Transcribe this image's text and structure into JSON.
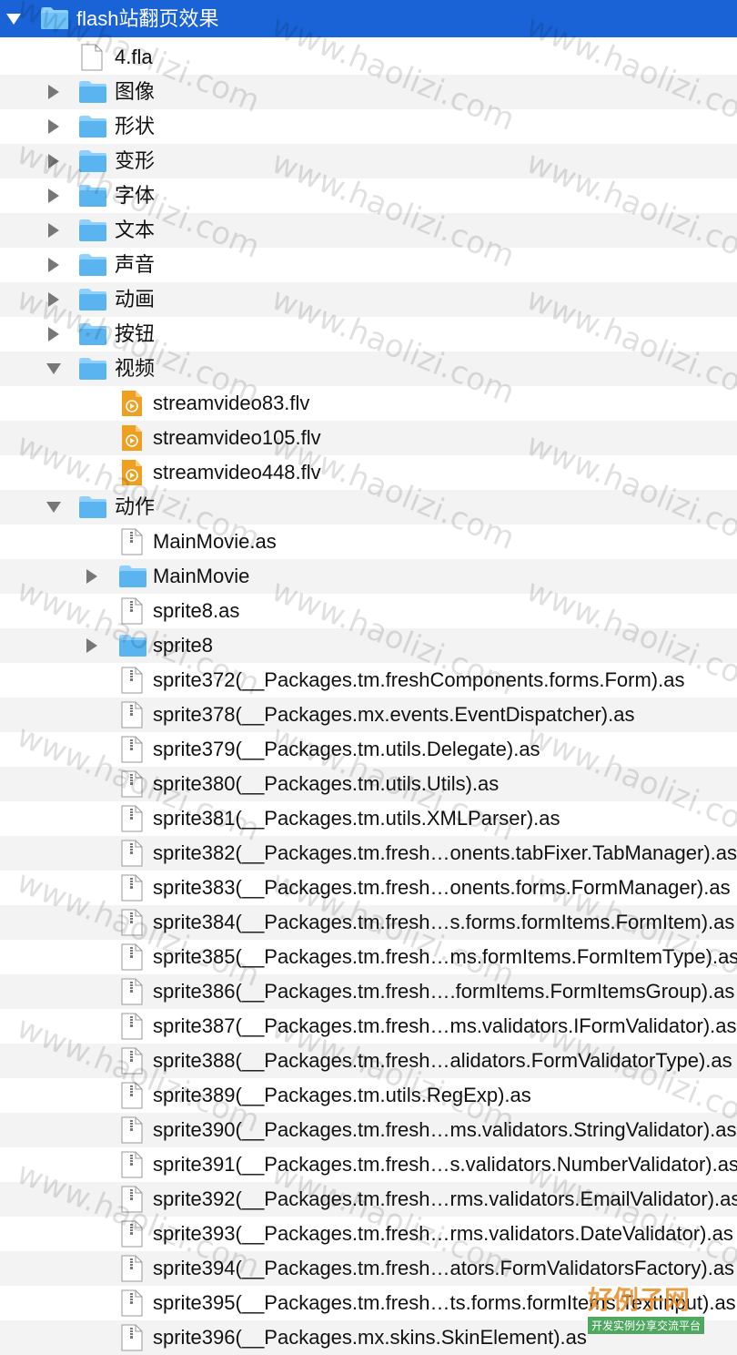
{
  "tree": {
    "root": {
      "label": "flash站翻页效果",
      "expanded": true
    },
    "rows": [
      {
        "type": "file",
        "label": "4.fla"
      },
      {
        "type": "folder",
        "label": "图像",
        "expanded": false
      },
      {
        "type": "folder",
        "label": "形状",
        "expanded": false
      },
      {
        "type": "folder",
        "label": "变形",
        "expanded": false
      },
      {
        "type": "folder",
        "label": "字体",
        "expanded": false
      },
      {
        "type": "folder",
        "label": "文本",
        "expanded": false
      },
      {
        "type": "folder",
        "label": "声音",
        "expanded": false
      },
      {
        "type": "folder",
        "label": "动画",
        "expanded": false
      },
      {
        "type": "folder",
        "label": "按钮",
        "expanded": false
      },
      {
        "type": "folder",
        "label": "视频",
        "expanded": true
      },
      {
        "type": "video",
        "label": "streamvideo83.flv"
      },
      {
        "type": "video",
        "label": "streamvideo105.flv"
      },
      {
        "type": "video",
        "label": "streamvideo448.flv"
      },
      {
        "type": "folder",
        "label": "动作",
        "expanded": true
      },
      {
        "type": "script",
        "label": "MainMovie.as"
      },
      {
        "type": "folder",
        "label": "MainMovie",
        "expanded": false
      },
      {
        "type": "script",
        "label": "sprite8.as"
      },
      {
        "type": "folder",
        "label": "sprite8",
        "expanded": false
      },
      {
        "type": "script",
        "label": "sprite372(__Packages.tm.freshComponents.forms.Form).as"
      },
      {
        "type": "script",
        "label": "sprite378(__Packages.mx.events.EventDispatcher).as"
      },
      {
        "type": "script",
        "label": "sprite379(__Packages.tm.utils.Delegate).as"
      },
      {
        "type": "script",
        "label": "sprite380(__Packages.tm.utils.Utils).as"
      },
      {
        "type": "script",
        "label": "sprite381(__Packages.tm.utils.XMLParser).as"
      },
      {
        "type": "script",
        "label": "sprite382(__Packages.tm.fresh…onents.tabFixer.TabManager).as"
      },
      {
        "type": "script",
        "label": "sprite383(__Packages.tm.fresh…onents.forms.FormManager).as"
      },
      {
        "type": "script",
        "label": "sprite384(__Packages.tm.fresh…s.forms.formItems.FormItem).as"
      },
      {
        "type": "script",
        "label": "sprite385(__Packages.tm.fresh…ms.formItems.FormItemType).as"
      },
      {
        "type": "script",
        "label": "sprite386(__Packages.tm.fresh….formItems.FormItemsGroup).as"
      },
      {
        "type": "script",
        "label": "sprite387(__Packages.tm.fresh…ms.validators.IFormValidator).as"
      },
      {
        "type": "script",
        "label": "sprite388(__Packages.tm.fresh…alidators.FormValidatorType).as"
      },
      {
        "type": "script",
        "label": "sprite389(__Packages.tm.utils.RegExp).as"
      },
      {
        "type": "script",
        "label": "sprite390(__Packages.tm.fresh…ms.validators.StringValidator).as"
      },
      {
        "type": "script",
        "label": "sprite391(__Packages.tm.fresh…s.validators.NumberValidator).as"
      },
      {
        "type": "script",
        "label": "sprite392(__Packages.tm.fresh…rms.validators.EmailValidator).as"
      },
      {
        "type": "script",
        "label": "sprite393(__Packages.tm.fresh…rms.validators.DateValidator).as"
      },
      {
        "type": "script",
        "label": "sprite394(__Packages.tm.fresh…ators.FormValidatorsFactory).as"
      },
      {
        "type": "script",
        "label": "sprite395(__Packages.tm.fresh…ts.forms.formItems.TextInput).as"
      },
      {
        "type": "script",
        "label": "sprite396(__Packages.mx.skins.SkinElement).as"
      }
    ]
  },
  "watermark": "www.haolizi.com",
  "brand": {
    "main": "好例子网",
    "sub": "开发实例分享交流平台"
  },
  "colors": {
    "selection": "#1a63d6",
    "folder": "#5ab4f0",
    "video": "#f0a020",
    "alt_row": "#f3f3f3"
  }
}
